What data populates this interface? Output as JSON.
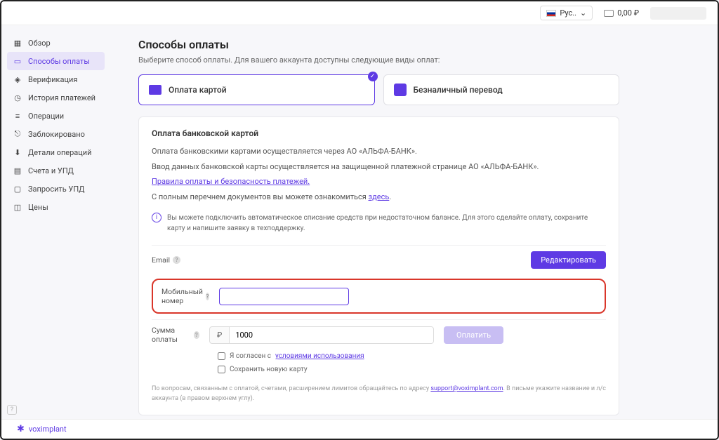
{
  "topbar": {
    "lang_label": "Рус..",
    "balance": "0,00 ₽"
  },
  "sidebar": {
    "items": [
      {
        "label": "Обзор"
      },
      {
        "label": "Способы оплаты"
      },
      {
        "label": "Верификация"
      },
      {
        "label": "История платежей"
      },
      {
        "label": "Операции"
      },
      {
        "label": "Заблокировано"
      },
      {
        "label": "Детали операций"
      },
      {
        "label": "Счета и УПД"
      },
      {
        "label": "Запросить УПД"
      },
      {
        "label": "Цены"
      }
    ]
  },
  "page": {
    "title": "Способы оплаты",
    "subtitle": "Выберите способ оплаты. Для вашего аккаунта доступны следующие виды оплат:"
  },
  "options": {
    "card": "Оплата картой",
    "transfer": "Безналичный перевод"
  },
  "panel": {
    "title": "Оплата банковской картой",
    "line1": "Оплата банковскими картами осуществляется через АО «АЛЬФА-БАНК».",
    "line2": "Ввод данных банковской карты осуществляется на защищенной платежной странице АО «АЛЬФА-БАНК».",
    "link1": "Правила оплаты и безопасность платежей.",
    "line3_a": "С полным перечнем документов вы можете ознакомиться ",
    "line3_link": "здесь",
    "info": "Вы можете подключить автоматическое списание средств при недостаточном балансе. Для этого сделайте оплату, сохраните карту и напишите заявку в техподдержку."
  },
  "form": {
    "email_label": "Email",
    "email_value": "",
    "edit_btn": "Редактировать",
    "phone_label": "Мобильный номер",
    "phone_value": "",
    "amount_label": "Сумма оплаты",
    "currency": "₽",
    "amount_value": "1000",
    "pay_btn": "Оплатить",
    "agree_a": "Я согласен с ",
    "agree_link": "условиями использования",
    "save_card": "Сохранить новую карту"
  },
  "footnote": {
    "text_a": "По вопросам, связанным с оплатой, счетами, расширением лимитов обращайтесь по адресу ",
    "email": "support@voximplant.com",
    "text_b": ". В письме укажите название и л/с аккаунта (в правом верхнем углу)."
  },
  "footer": {
    "brand": "voximplant"
  }
}
